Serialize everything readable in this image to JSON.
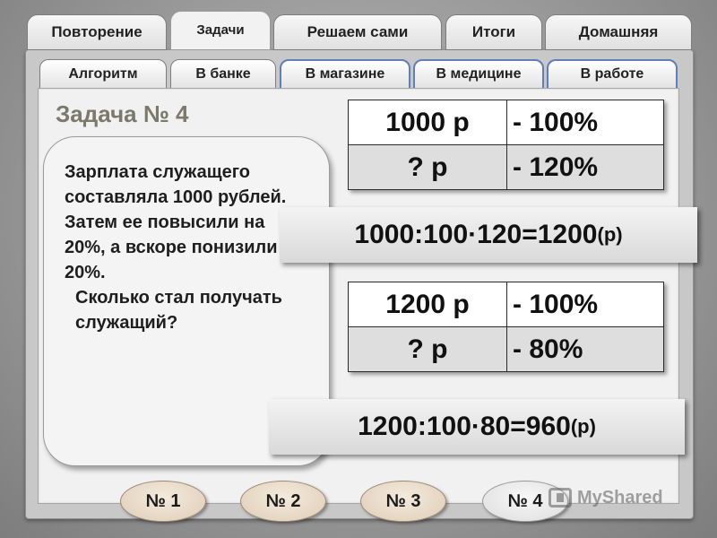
{
  "tabs": [
    {
      "label": "Повторение"
    },
    {
      "label": "Задачи"
    },
    {
      "label": "Решаем сами"
    },
    {
      "label": "Итоги"
    },
    {
      "label": "Домашняя"
    }
  ],
  "subtabs": [
    {
      "label": "Алгоритм"
    },
    {
      "label": "В банке"
    },
    {
      "label": "В магазине"
    },
    {
      "label": "В медицине"
    },
    {
      "label": "В работе"
    }
  ],
  "task": {
    "title": "Задача № 4",
    "text": "Зарплата служащего составляла 1000 рублей. Затем ее повысили на 20%, а вскоре понизили на 20%.",
    "question": "Сколько стал получать служащий?"
  },
  "table1": {
    "rows": [
      {
        "a": "1000 р",
        "b": "- 100%"
      },
      {
        "a": "? р",
        "b": "- 120%"
      }
    ]
  },
  "formula1": {
    "expr": "1000:100·120=1200",
    "unit": "(р)"
  },
  "table2": {
    "rows": [
      {
        "a": "1200 р",
        "b": "- 100%"
      },
      {
        "a": "? р",
        "b": "- 80%"
      }
    ]
  },
  "formula2": {
    "expr": "1200:100·80=960",
    "unit": "(р)"
  },
  "nav": [
    {
      "label": "№ 1"
    },
    {
      "label": "№ 2"
    },
    {
      "label": "№ 3"
    },
    {
      "label": "№ 4"
    }
  ],
  "watermark": {
    "text": "MyShared"
  }
}
